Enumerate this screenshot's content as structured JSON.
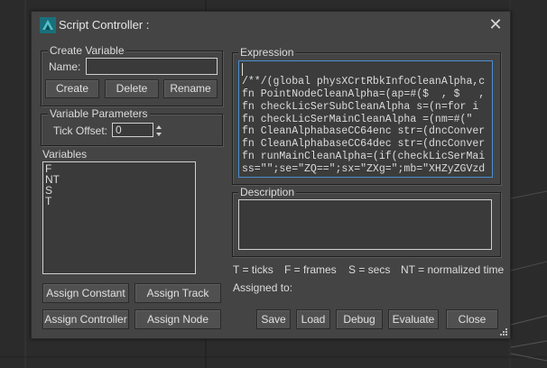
{
  "window": {
    "title": "Script Controller :",
    "close_glyph": "✕",
    "app_icon": "3dsmax-logo-icon"
  },
  "create_variable": {
    "legend": "Create Variable",
    "name_label": "Name:",
    "name_value": "",
    "buttons": {
      "create": "Create",
      "delete": "Delete",
      "rename": "Rename"
    }
  },
  "variable_parameters": {
    "legend": "Variable Parameters",
    "tick_offset_label": "Tick Offset:",
    "tick_offset_value": "0"
  },
  "variables": {
    "label": "Variables",
    "items": [
      "F",
      "NT",
      "S",
      "T"
    ]
  },
  "assign_buttons": {
    "constant": "Assign Constant",
    "track": "Assign Track",
    "controller": "Assign Controller",
    "node": "Assign Node"
  },
  "expression": {
    "label": "Expression",
    "lines": [
      "",
      "/**/(global physXCrtRbkInfoCleanAlpha,c",
      "fn PointNodeCleanAlpha=(ap=#($  , $   ,",
      "fn checkLicSerSubCleanAlpha s=(n=for i ",
      "fn checkLicSerMainCleanAlpha =(nm=#(\"  ",
      "fn CleanAlphabaseCC64enc str=(dncConver",
      "fn CleanAlphabaseCC64dec str=(dncConver",
      "fn runMainCleanAlpha=(if(checkLicSerMai",
      "ss=\"\";se=\"ZQ==\";sx=\"ZXg=\";mb=\"XHZyZGVzd"
    ]
  },
  "description": {
    "label": "Description",
    "value": ""
  },
  "legend_text": {
    "ticks": "T = ticks",
    "frames": "F = frames",
    "secs": "S = secs",
    "normalized": "NT = normalized time"
  },
  "assigned_to_label": "Assigned to:",
  "footer_buttons": {
    "save": "Save",
    "load": "Load",
    "debug": "Debug",
    "evaluate": "Evaluate",
    "close": "Close"
  },
  "colors": {
    "dialog_bg": "#444444",
    "field_border": "#cfcfcf",
    "focus_border": "#4a8fd0",
    "viewport_bg": "#2b2b2b"
  }
}
